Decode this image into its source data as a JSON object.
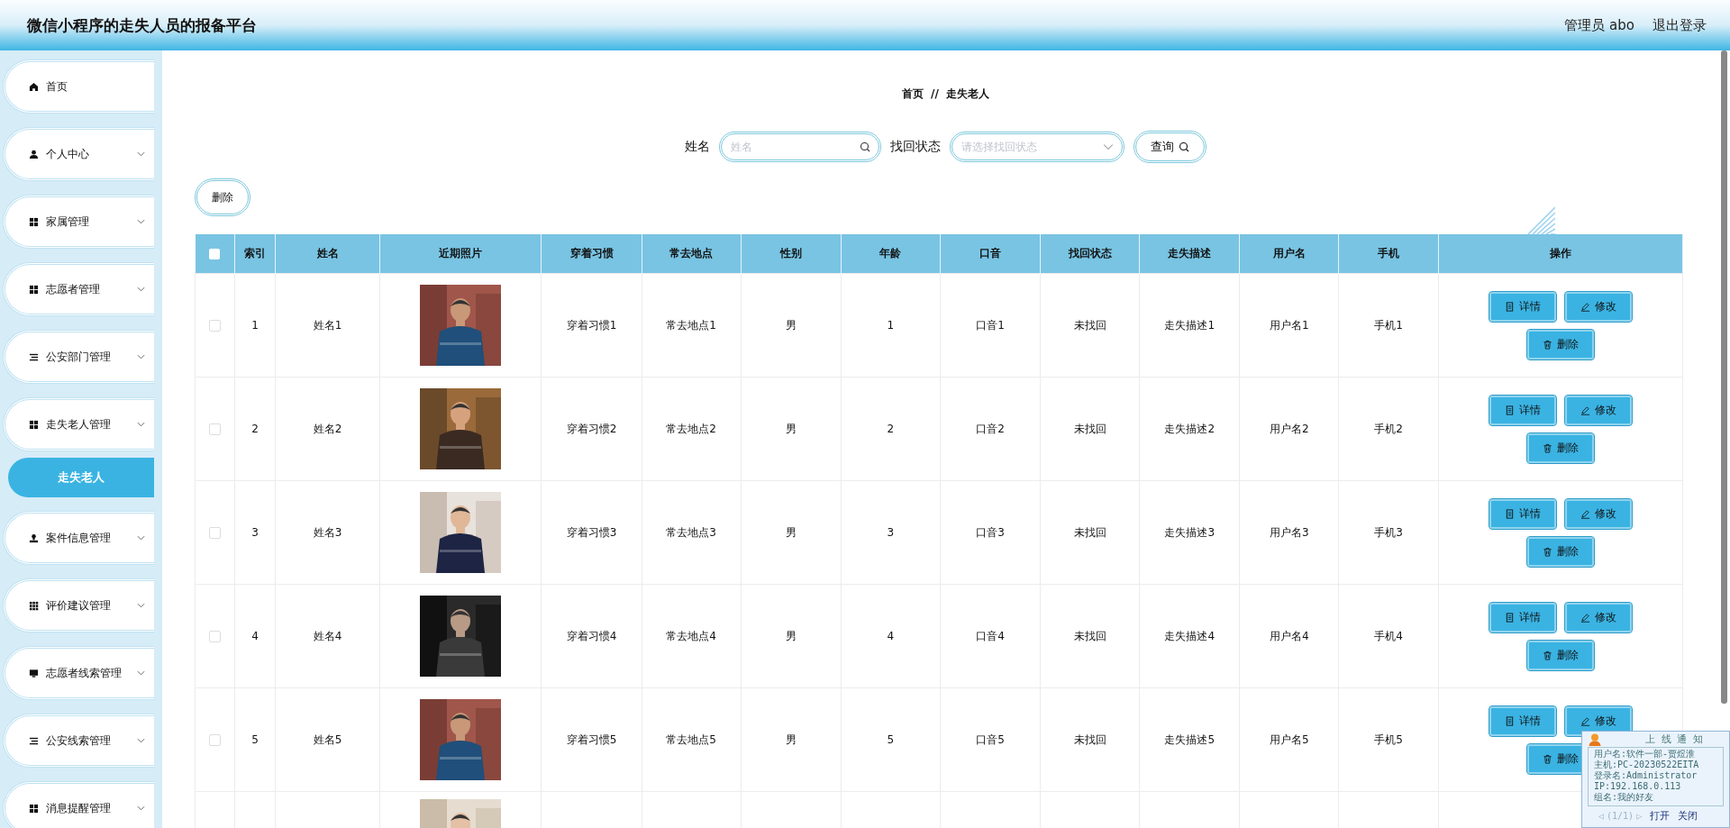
{
  "header": {
    "title": "微信小程序的走失人员的报备平台",
    "user": "管理员 abo",
    "logout": "退出登录"
  },
  "sidebar": {
    "items": [
      {
        "label": "首页",
        "kind": "menu",
        "expandable": false,
        "selected": false
      },
      {
        "label": "个人中心",
        "kind": "menu",
        "expandable": true,
        "selected": false
      },
      {
        "label": "家属管理",
        "kind": "menu",
        "expandable": true,
        "selected": false
      },
      {
        "label": "志愿者管理",
        "kind": "menu",
        "expandable": true,
        "selected": false
      },
      {
        "label": "公安部门管理",
        "kind": "menu",
        "expandable": true,
        "selected": false
      },
      {
        "label": "走失老人管理",
        "kind": "menu",
        "expandable": true,
        "selected": false
      },
      {
        "label": "走失老人",
        "kind": "submenu",
        "expandable": false,
        "selected": true
      },
      {
        "label": "案件信息管理",
        "kind": "menu",
        "expandable": true,
        "selected": false
      },
      {
        "label": "评价建议管理",
        "kind": "menu",
        "expandable": true,
        "selected": false
      },
      {
        "label": "志愿者线索管理",
        "kind": "menu",
        "expandable": true,
        "selected": false
      },
      {
        "label": "公安线索管理",
        "kind": "menu",
        "expandable": true,
        "selected": false
      },
      {
        "label": "消息提醒管理",
        "kind": "menu",
        "expandable": true,
        "selected": false
      }
    ]
  },
  "breadcrumb": {
    "home": "首页",
    "separator": "//",
    "current": "走失老人"
  },
  "search": {
    "fields": [
      {
        "label": "姓名",
        "placeholder": "姓名",
        "kind": "text"
      },
      {
        "label": "找回状态",
        "placeholder": "请选择找回状态",
        "kind": "select"
      }
    ],
    "button": "查询"
  },
  "delete_button": "删除",
  "table": {
    "header_checked": false,
    "columns": [
      "索引",
      "姓名",
      "近期照片",
      "穿着习惯",
      "常去地点",
      "性别",
      "年龄",
      "口音",
      "找回状态",
      "走失描述",
      "用户名",
      "手机",
      "操作"
    ],
    "rows": [
      {
        "checked": false,
        "cells": [
          "1",
          "姓名1",
          {
            "kind": "picture"
          },
          "穿着习惯1",
          "常去地点1",
          "男",
          "1",
          "口音1",
          "未找回",
          "走失描述1",
          "用户名1",
          "手机1"
        ],
        "actions": [
          {
            "label": "详情",
            "kind": "detail"
          },
          {
            "label": "修改",
            "kind": "edit"
          },
          {
            "label": "删除",
            "kind": "delete"
          }
        ]
      },
      {
        "checked": false,
        "cells": [
          "2",
          "姓名2",
          {
            "kind": "picture"
          },
          "穿着习惯2",
          "常去地点2",
          "男",
          "2",
          "口音2",
          "未找回",
          "走失描述2",
          "用户名2",
          "手机2"
        ],
        "actions": [
          {
            "label": "详情",
            "kind": "detail"
          },
          {
            "label": "修改",
            "kind": "edit"
          },
          {
            "label": "删除",
            "kind": "delete"
          }
        ]
      },
      {
        "checked": false,
        "cells": [
          "3",
          "姓名3",
          {
            "kind": "picture"
          },
          "穿着习惯3",
          "常去地点3",
          "男",
          "3",
          "口音3",
          "未找回",
          "走失描述3",
          "用户名3",
          "手机3"
        ],
        "actions": [
          {
            "label": "详情",
            "kind": "detail"
          },
          {
            "label": "修改",
            "kind": "edit"
          },
          {
            "label": "删除",
            "kind": "delete"
          }
        ]
      },
      {
        "checked": false,
        "cells": [
          "4",
          "姓名4",
          {
            "kind": "picture"
          },
          "穿着习惯4",
          "常去地点4",
          "男",
          "4",
          "口音4",
          "未找回",
          "走失描述4",
          "用户名4",
          "手机4"
        ],
        "actions": [
          {
            "label": "详情",
            "kind": "detail"
          },
          {
            "label": "修改",
            "kind": "edit"
          },
          {
            "label": "删除",
            "kind": "delete"
          }
        ]
      },
      {
        "checked": false,
        "cells": [
          "5",
          "姓名5",
          {
            "kind": "picture"
          },
          "穿着习惯5",
          "常去地点5",
          "男",
          "5",
          "口音5",
          "未找回",
          "走失描述5",
          "用户名5",
          "手机5"
        ],
        "actions": [
          {
            "label": "详情",
            "kind": "detail"
          },
          {
            "label": "修改",
            "kind": "edit"
          },
          {
            "label": "删除",
            "kind": "delete"
          }
        ]
      }
    ],
    "partial_row": {
      "photo": {
        "kind": "picture"
      }
    }
  },
  "notice": {
    "title": "上 线 通 知",
    "lines": [
      "用户名:软件一部-贾煜淮",
      "主机:PC-20230522EITA",
      "登录名:Administrator",
      "IP:192.168.0.113",
      "组名:我的好友"
    ],
    "prev": "◁",
    "pager": "(1/1)",
    "next": "▷",
    "open": "打开",
    "close": "关闭"
  }
}
